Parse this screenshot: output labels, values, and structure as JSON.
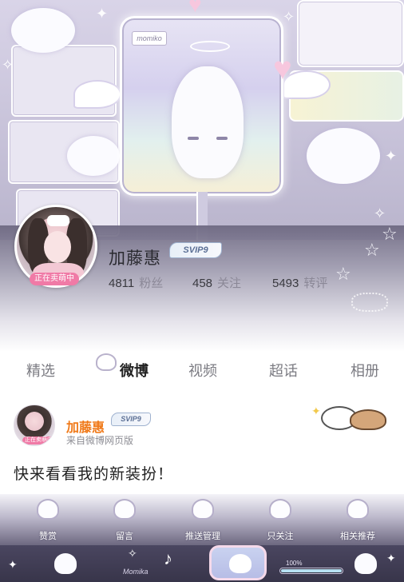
{
  "profile": {
    "username": "加藤惠",
    "vip_badge": "SVIP9",
    "live_badge": "正在卖萌中",
    "stats": [
      {
        "value": "4811",
        "label": "粉丝"
      },
      {
        "value": "458",
        "label": "关注"
      },
      {
        "value": "5493",
        "label": "转评"
      }
    ]
  },
  "banner": {
    "monitor_tag": "momiko"
  },
  "tabs": [
    {
      "label": "精选",
      "active": false
    },
    {
      "label": "微博",
      "active": true
    },
    {
      "label": "视频",
      "active": false
    },
    {
      "label": "超话",
      "active": false
    },
    {
      "label": "相册",
      "active": false
    }
  ],
  "post": {
    "author": "加藤惠",
    "vip_badge": "SVIP9",
    "avatar_badge": "正在卖萌中",
    "source": "来自微博网页版",
    "text": "快来看看我的新装扮！"
  },
  "actions": [
    {
      "label": "赞赏",
      "icon": "heart-bubble-icon"
    },
    {
      "label": "留言",
      "icon": "message-icon"
    },
    {
      "label": "推送管理",
      "icon": "bell-icon"
    },
    {
      "label": "只关注",
      "icon": "follow-icon"
    },
    {
      "label": "相关推荐",
      "icon": "recommend-icon"
    }
  ],
  "bottom_nav": {
    "brand_text": "Momika",
    "progress_label": "100%",
    "progress_value": 1.0
  },
  "colors": {
    "accent_orange": "#f07a1a",
    "badge_pink": "#f07aa6",
    "vip_blue": "#5b6f95"
  }
}
